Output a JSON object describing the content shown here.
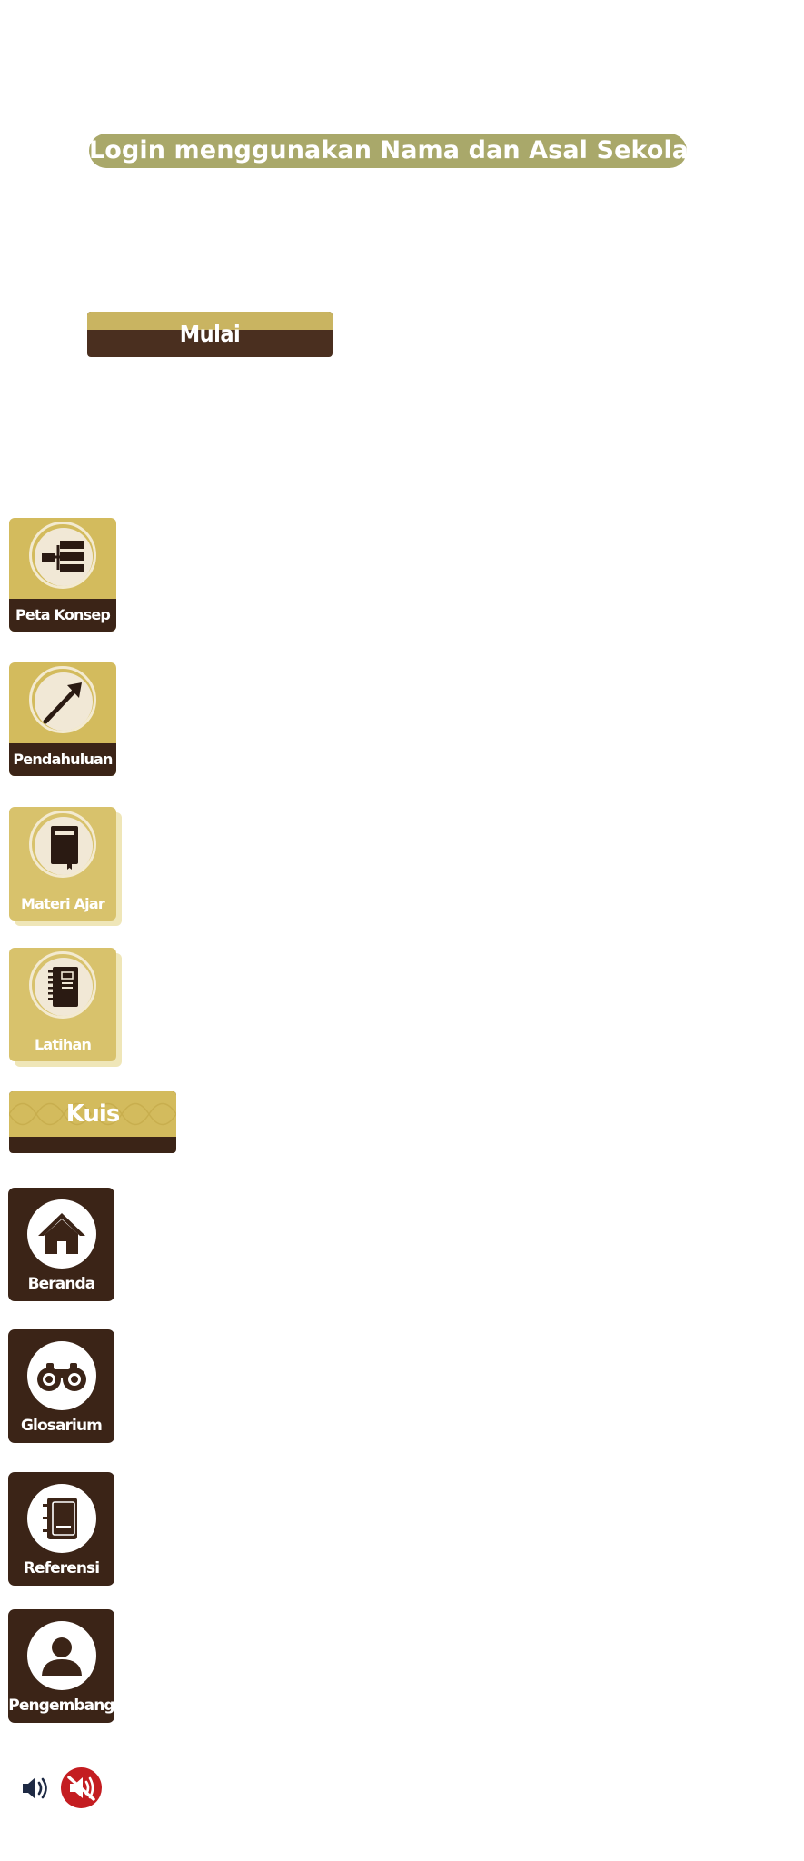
{
  "login": {
    "title": "Login menggunakan Nama dan Asal Sekolah",
    "start_label": "Mulai"
  },
  "menu": {
    "peta_konsep": "Peta Konsep",
    "pendahuluan": "Pendahuluan",
    "materi_ajar": "Materi Ajar",
    "latihan": "Latihan",
    "kuis": "Kuis"
  },
  "nav": {
    "beranda": "Beranda",
    "glosarium": "Glosarium",
    "referensi": "Referensi",
    "pengembang": "Pengembang"
  },
  "audio": {
    "on_icon": "speaker-icon",
    "off_icon": "speaker-muted-icon"
  },
  "colors": {
    "gold": "#d3bb5d",
    "dark_brown": "#3b2417",
    "pill": "#a9a86a",
    "mute_red": "#c41d21"
  }
}
